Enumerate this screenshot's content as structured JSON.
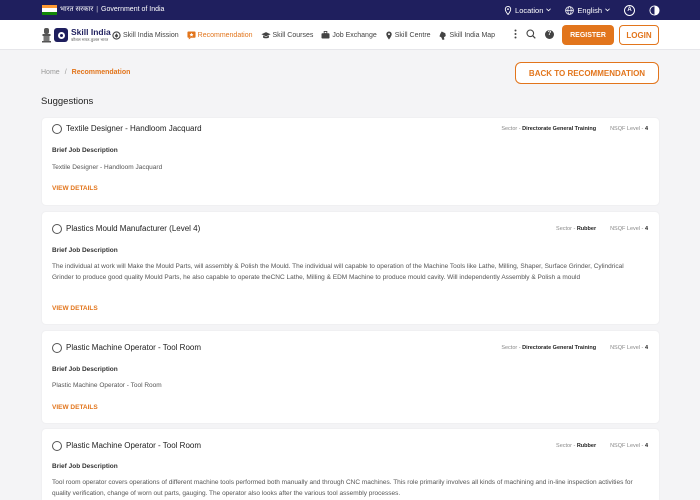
{
  "gov_bar": {
    "hindi": "भारत सरकार",
    "english": "Government of India",
    "location_label": "Location",
    "language_label": "English",
    "accessibility_glyph": "A",
    "flag_colors": [
      "#FF9933",
      "#FFFFFF",
      "#138808"
    ]
  },
  "brand": {
    "name": "Skill India",
    "tagline": "कौशल भारत-कुशल भारत",
    "accent": "#e2751c",
    "navy": "#1f1f5e"
  },
  "nav": {
    "items": [
      {
        "label": "Skill India Mission",
        "icon": "mission-icon",
        "active": false
      },
      {
        "label": "Recommendation",
        "icon": "recommendation-icon",
        "active": true
      },
      {
        "label": "Skill Courses",
        "icon": "graduation-cap-icon",
        "active": false
      },
      {
        "label": "Job Exchange",
        "icon": "briefcase-icon",
        "active": false
      },
      {
        "label": "Skill Centre",
        "icon": "map-pin-icon",
        "active": false
      },
      {
        "label": "Skill India Map",
        "icon": "map-icon",
        "active": false
      }
    ],
    "help_glyph": "?",
    "register_label": "REGISTER",
    "login_label": "LOGIN"
  },
  "breadcrumb": {
    "home": "Home",
    "separator": "/",
    "current": "Recommendation"
  },
  "back_button": "BACK TO RECOMMENDATION",
  "section_title": "Suggestions",
  "labels": {
    "sector": "Sector -",
    "nsqf": "NSQF Level -",
    "brief": "Brief Job Description",
    "view_details": "VIEW DETAILS"
  },
  "jobs": [
    {
      "title": "Textile Designer - Handloom Jacquard",
      "sector": "Directorate General Training",
      "nsqf": "4",
      "description": "Textile Designer - Handloom Jacquard"
    },
    {
      "title": "Plastics Mould Manufacturer (Level 4)",
      "sector": "Rubber",
      "nsqf": "4",
      "description": "The individual at work will Make the Mould Parts, will assembly & Polish the Mould. The individual will capable to operation of the Machine Tools like Lathe, Milling, Shaper, Surface Grinder, Cylindrical Grinder to produce good quality Mould Parts, he also capable to operate theCNC Lathe, Milling & EDM Machine to produce mould cavity. Will independently Assembly & Polish a mould"
    },
    {
      "title": "Plastic Machine Operator - Tool Room",
      "sector": "Directorate General Training",
      "nsqf": "4",
      "description": "Plastic Machine Operator - Tool Room"
    },
    {
      "title": "Plastic Machine Operator - Tool Room",
      "sector": "Rubber",
      "nsqf": "4",
      "description": "Tool room operator covers operations of different machine tools performed both manually and through CNC machines. This role primarily involves all kinds of machining and in-line inspection activities for quality verification, change of worn out parts, gauging. The operator also looks after the various tool assembly processes."
    }
  ]
}
